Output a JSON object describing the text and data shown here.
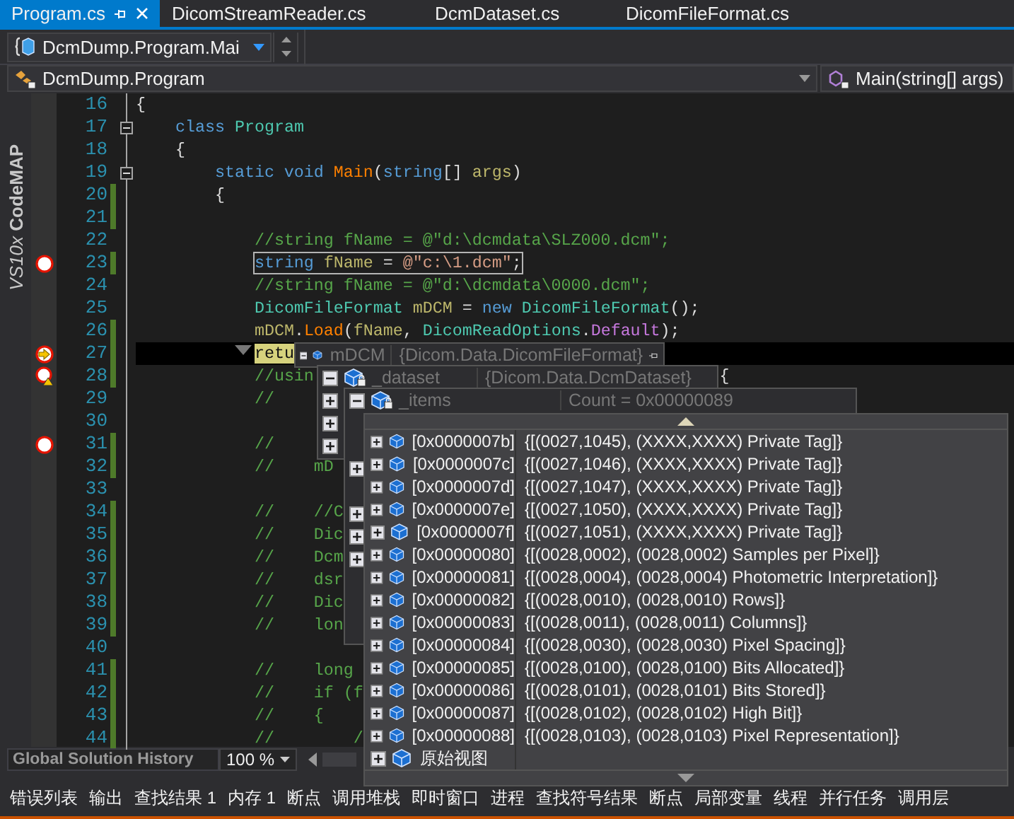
{
  "tabs": [
    {
      "label": "Program.cs",
      "selected": true
    },
    {
      "label": "DicomStreamReader.cs",
      "selected": false
    },
    {
      "label": "DcmDataset.cs",
      "selected": false
    },
    {
      "label": "DicomFileFormat.cs",
      "selected": false
    }
  ],
  "scope": {
    "value": "DcmDump.Program.Mai"
  },
  "navigation": {
    "type": "DcmDump.Program",
    "member": "Main(string[] args)"
  },
  "codemap": "*VS10x* **CodeMAP**",
  "code": {
    "lines": [
      {
        "number": "16",
        "changed": false,
        "fold": false,
        "framed": false,
        "active": false,
        "tokens": [
          {
            "text": "{",
            "kind": "punct"
          }
        ]
      },
      {
        "number": "17",
        "changed": false,
        "fold": true,
        "framed": false,
        "active": false,
        "tokens": [
          {
            "text": "    class ",
            "kind": "kw"
          },
          {
            "text": "Program",
            "kind": "type"
          }
        ]
      },
      {
        "number": "18",
        "changed": false,
        "fold": false,
        "framed": false,
        "active": false,
        "tokens": [
          {
            "text": "    {",
            "kind": "punct"
          }
        ]
      },
      {
        "number": "19",
        "changed": false,
        "fold": true,
        "framed": false,
        "active": false,
        "tokens": [
          {
            "text": "        static void ",
            "kind": "kw"
          },
          {
            "text": "Main",
            "kind": "method"
          },
          {
            "text": "(",
            "kind": "punct"
          },
          {
            "text": "string",
            "kind": "kw"
          },
          {
            "text": "[] ",
            "kind": "punct"
          },
          {
            "text": "args",
            "kind": "ident"
          },
          {
            "text": ")",
            "kind": "punct"
          }
        ]
      },
      {
        "number": "20",
        "changed": true,
        "fold": false,
        "framed": false,
        "active": false,
        "tokens": [
          {
            "text": "        {",
            "kind": "punct"
          }
        ]
      },
      {
        "number": "21",
        "changed": true,
        "fold": false,
        "framed": false,
        "active": false
      },
      {
        "number": "22",
        "changed": false,
        "fold": false,
        "framed": false,
        "active": false,
        "tokens": [
          {
            "text": "            //string fName = @\"d:\\dcmdata\\SLZ000.dcm\";",
            "kind": "comment"
          }
        ]
      },
      {
        "number": "23",
        "changed": true,
        "fold": false,
        "framed": true,
        "active": false,
        "kind": "breakpoint",
        "tokens": [
          {
            "text": "            string ",
            "kind": "kw"
          },
          {
            "text": "fName",
            "kind": "ident"
          },
          {
            "text": " = ",
            "kind": "punct"
          },
          {
            "text": "@\"c:\\1.dcm\"",
            "kind": "string"
          },
          {
            "text": ";",
            "kind": "punct"
          }
        ]
      },
      {
        "number": "24",
        "changed": false,
        "fold": false,
        "framed": false,
        "active": false,
        "tokens": [
          {
            "text": "            //string fName = @\"d:\\dcmdata\\0000.dcm\";",
            "kind": "comment"
          }
        ]
      },
      {
        "number": "25",
        "changed": false,
        "fold": false,
        "framed": false,
        "active": false,
        "tokens": [
          {
            "text": "            DicomFileFormat",
            "kind": "type"
          },
          {
            "text": " mDCM",
            "kind": "ident"
          },
          {
            "text": " = ",
            "kind": "punct"
          },
          {
            "text": "new ",
            "kind": "kw"
          },
          {
            "text": "DicomFileFormat",
            "kind": "type"
          },
          {
            "text": "();",
            "kind": "punct"
          }
        ]
      },
      {
        "number": "26",
        "changed": true,
        "fold": false,
        "framed": false,
        "active": false,
        "tokens": [
          {
            "text": "            mDCM",
            "kind": "ident"
          },
          {
            "text": ".",
            "kind": "punct"
          },
          {
            "text": "Load",
            "kind": "method"
          },
          {
            "text": "(",
            "kind": "punct"
          },
          {
            "text": "fName",
            "kind": "ident"
          },
          {
            "text": ", ",
            "kind": "punct"
          },
          {
            "text": "DicomReadOptions",
            "kind": "type"
          },
          {
            "text": ".",
            "kind": "punct"
          },
          {
            "text": "Default",
            "kind": "member"
          },
          {
            "text": ");",
            "kind": "punct"
          }
        ]
      },
      {
        "number": "27",
        "changed": true,
        "fold": false,
        "framed": false,
        "active": true,
        "kind": "current",
        "tokens": [
          {
            "text": "            retu",
            "kind": "current"
          }
        ]
      },
      {
        "number": "28",
        "changed": true,
        "fold": false,
        "framed": false,
        "active": false,
        "kind": "warning",
        "tokens": [
          {
            "text": "            //usin",
            "kind": "comment"
          },
          {
            "text": "                                         {",
            "kind": "punct"
          }
        ]
      },
      {
        "number": "29",
        "changed": false,
        "fold": false,
        "framed": false,
        "active": false,
        "tokens": [
          {
            "text": "            //",
            "kind": "comment"
          }
        ]
      },
      {
        "number": "30",
        "changed": false,
        "fold": false,
        "framed": false,
        "active": false
      },
      {
        "number": "31",
        "changed": true,
        "fold": false,
        "framed": false,
        "active": false,
        "kind": "breakpoint",
        "tokens": [
          {
            "text": "            //",
            "kind": "comment"
          }
        ]
      },
      {
        "number": "32",
        "changed": true,
        "fold": false,
        "framed": false,
        "active": false,
        "tokens": [
          {
            "text": "            //    mD",
            "kind": "comment"
          }
        ]
      },
      {
        "number": "33",
        "changed": false,
        "fold": false,
        "framed": false,
        "active": false
      },
      {
        "number": "34",
        "changed": true,
        "fold": false,
        "framed": false,
        "active": false,
        "tokens": [
          {
            "text": "            //    //C",
            "kind": "comment"
          }
        ]
      },
      {
        "number": "35",
        "changed": true,
        "fold": false,
        "framed": false,
        "active": false,
        "tokens": [
          {
            "text": "            //    Dic",
            "kind": "comment"
          }
        ]
      },
      {
        "number": "36",
        "changed": true,
        "fold": false,
        "framed": false,
        "active": false,
        "tokens": [
          {
            "text": "            //    Dcm",
            "kind": "comment"
          }
        ]
      },
      {
        "number": "37",
        "changed": true,
        "fold": false,
        "framed": false,
        "active": false,
        "tokens": [
          {
            "text": "            //    dsr",
            "kind": "comment"
          }
        ]
      },
      {
        "number": "38",
        "changed": true,
        "fold": false,
        "framed": false,
        "active": false,
        "tokens": [
          {
            "text": "            //    Dic",
            "kind": "comment"
          }
        ]
      },
      {
        "number": "39",
        "changed": true,
        "fold": false,
        "framed": false,
        "active": false,
        "tokens": [
          {
            "text": "            //    lon",
            "kind": "comment"
          }
        ]
      },
      {
        "number": "40",
        "changed": false,
        "fold": false,
        "framed": false,
        "active": false
      },
      {
        "number": "41",
        "changed": true,
        "fold": false,
        "framed": false,
        "active": false,
        "tokens": [
          {
            "text": "            //    long",
            "kind": "comment"
          }
        ]
      },
      {
        "number": "42",
        "changed": true,
        "fold": false,
        "framed": false,
        "active": false,
        "tokens": [
          {
            "text": "            //    if (f",
            "kind": "comment"
          }
        ]
      },
      {
        "number": "43",
        "changed": true,
        "fold": false,
        "framed": false,
        "active": false,
        "tokens": [
          {
            "text": "            //    {",
            "kind": "comment"
          }
        ]
      },
      {
        "number": "44",
        "changed": true,
        "fold": false,
        "framed": false,
        "active": false,
        "tokens": [
          {
            "text": "            //        /",
            "kind": "comment"
          }
        ]
      }
    ]
  },
  "datatip": {
    "levels": [
      {
        "name": "mDCM",
        "value": "{Dicom.Data.DicomFileFormat}",
        "expanded": true,
        "locked": false
      },
      {
        "name": "_dataset",
        "value": "{Dicom.Data.DcmDataset}",
        "expanded": true,
        "locked": true,
        "rows": [
          {
            "expandable": true
          },
          {
            "expandable": true
          },
          {
            "expandable": true
          }
        ]
      },
      {
        "name": "_items",
        "value": "Count = 0x00000089",
        "expanded": true,
        "locked": true,
        "rows": [
          {
            "expandable": true
          },
          {
            "expandable": false
          },
          {
            "expandable": true
          },
          {
            "expandable": true
          },
          {
            "expandable": true
          }
        ]
      }
    ],
    "entries": [
      {
        "index": "[0x0000007b]",
        "value": "{[(0027,1045), (XXXX,XXXX) Private Tag]}",
        "expanded": false
      },
      {
        "index": "[0x0000007c]",
        "value": "{[(0027,1046), (XXXX,XXXX) Private Tag]}",
        "expanded": false
      },
      {
        "index": "[0x0000007d]",
        "value": "{[(0027,1047), (XXXX,XXXX) Private Tag]}",
        "expanded": false
      },
      {
        "index": "[0x0000007e]",
        "value": "{[(0027,1050), (XXXX,XXXX) Private Tag]}",
        "expanded": false
      },
      {
        "index": "[0x0000007f]",
        "value": "{[(0027,1051), (XXXX,XXXX) Private Tag]}",
        "expanded": false
      },
      {
        "index": "[0x00000080]",
        "value": "{[(0028,0002), (0028,0002) Samples per Pixel]}",
        "expanded": false
      },
      {
        "index": "[0x00000081]",
        "value": "{[(0028,0004), (0028,0004) Photometric Interpretation]}",
        "expanded": false
      },
      {
        "index": "[0x00000082]",
        "value": "{[(0028,0010), (0028,0010) Rows]}",
        "expanded": false
      },
      {
        "index": "[0x00000083]",
        "value": "{[(0028,0011), (0028,0011) Columns]}",
        "expanded": false
      },
      {
        "index": "[0x00000084]",
        "value": "{[(0028,0030), (0028,0030) Pixel Spacing]}",
        "expanded": false
      },
      {
        "index": "[0x00000085]",
        "value": "{[(0028,0100), (0028,0100) Bits Allocated]}",
        "expanded": false
      },
      {
        "index": "[0x00000086]",
        "value": "{[(0028,0101), (0028,0101) Bits Stored]}",
        "expanded": false
      },
      {
        "index": "[0x00000087]",
        "value": "{[(0028,0102), (0028,0102) High Bit]}",
        "expanded": false
      },
      {
        "index": "[0x00000088]",
        "value": "{[(0028,0103), (0028,0103) Pixel Representation]}",
        "expanded": false
      }
    ],
    "raw_view": {
      "label": "原始视图",
      "expanded": false
    }
  },
  "footer": {
    "history_search": {
      "placeholder": "Global Solution History"
    },
    "zoom": "100 %"
  },
  "tool_tabs": [
    {
      "label": "错误列表"
    },
    {
      "label": "输出"
    },
    {
      "label": "查找结果 1"
    },
    {
      "label": "内存 1"
    },
    {
      "label": "断点"
    },
    {
      "label": "调用堆栈"
    },
    {
      "label": "即时窗口"
    },
    {
      "label": "进程"
    },
    {
      "label": "查找符号结果"
    },
    {
      "label": "断点"
    },
    {
      "label": "局部变量"
    },
    {
      "label": "线程"
    },
    {
      "label": "并行任务"
    },
    {
      "label": "调用层"
    }
  ]
}
